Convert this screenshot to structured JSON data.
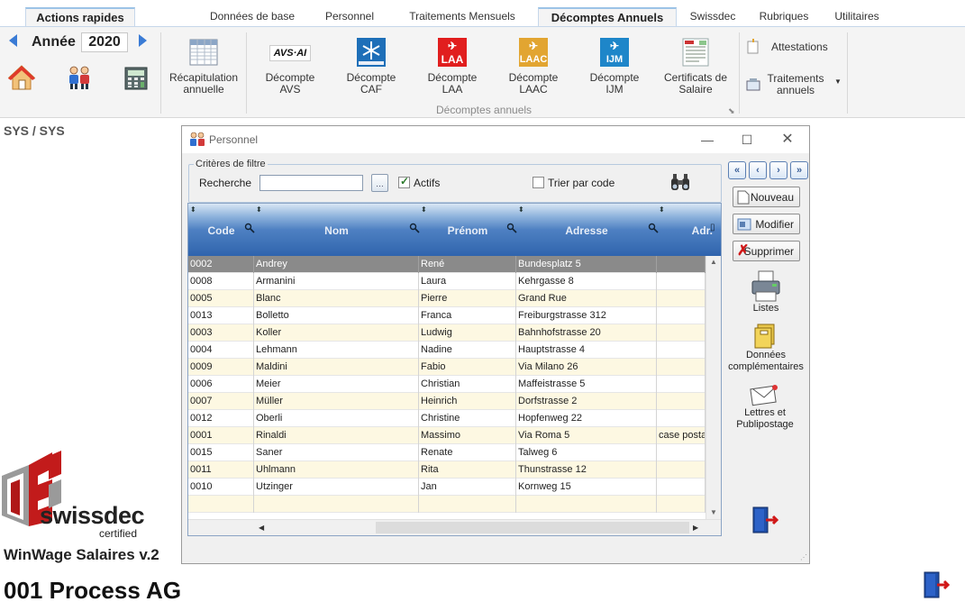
{
  "tabs": [
    "Actions rapides",
    "Données de base",
    "Personnel",
    "Traitements Mensuels",
    "Décomptes Annuels",
    "Swissdec",
    "Rubriques",
    "Utilitaires"
  ],
  "year": {
    "label": "Année",
    "value": "2020"
  },
  "ribbon": {
    "recap": "Récapitulation annuelle",
    "avs": "Décompte AVS",
    "caf": "Décompte CAF",
    "laa": "Décompte LAA",
    "laac": "Décompte LAAC",
    "ijm": "Décompte IJM",
    "certificats": "Certificats de Salaire",
    "group_label": "Décomptes annuels",
    "attestations": "Attestations",
    "traitements": "Traitements annuels",
    "icon_texts": {
      "avs": "AVS·AI",
      "laa": "LAA",
      "laac": "LAAC",
      "ijm": "IJM"
    }
  },
  "user": "SYS / SYS",
  "window": {
    "title": "Personnel",
    "filter": {
      "legend": "Critères de filtre",
      "search_label": "Recherche",
      "search_value": "",
      "actifs_label": "Actifs",
      "actifs_checked": true,
      "trier_label": "Trier par code",
      "trier_checked": false
    },
    "columns": [
      "Code",
      "Nom",
      "Prénom",
      "Adresse",
      "Adr."
    ],
    "rows": [
      [
        "0002",
        "Andrey",
        "René",
        "Bundesplatz 5",
        ""
      ],
      [
        "0008",
        "Armanini",
        "Laura",
        "Kehrgasse 8",
        ""
      ],
      [
        "0005",
        "Blanc",
        "Pierre",
        "Grand Rue",
        ""
      ],
      [
        "0013",
        "Bolletto",
        "Franca",
        "Freiburgstrasse 312",
        ""
      ],
      [
        "0003",
        "Koller",
        "Ludwig",
        "Bahnhofstrasse 20",
        ""
      ],
      [
        "0004",
        "Lehmann",
        "Nadine",
        "Hauptstrasse 4",
        ""
      ],
      [
        "0009",
        "Maldini",
        "Fabio",
        "Via Milano 26",
        ""
      ],
      [
        "0006",
        "Meier",
        "Christian",
        "Maffeistrasse 5",
        ""
      ],
      [
        "0007",
        "Müller",
        "Heinrich",
        "Dorfstrasse 2",
        ""
      ],
      [
        "0012",
        "Oberli",
        "Christine",
        "Hopfenweg 22",
        ""
      ],
      [
        "0001",
        "Rinaldi",
        "Massimo",
        "Via Roma 5",
        "case posta"
      ],
      [
        "0015",
        "Saner",
        "Renate",
        "Talweg 6",
        ""
      ],
      [
        "0011",
        "Uhlmann",
        "Rita",
        "Thunstrasse 12",
        ""
      ],
      [
        "0010",
        "Utzinger",
        "Jan",
        "Kornweg 15",
        ""
      ]
    ],
    "buttons": {
      "nouveau": "Nouveau",
      "modifier": "Modifier",
      "supprimer": "Supprimer"
    },
    "side": {
      "listes": "Listes",
      "donnees": "Données complémentaires",
      "lettres": "Lettres et Publipostage"
    }
  },
  "footer": {
    "swissdec": "swissdec",
    "certified": "certified",
    "app_version": "WinWage Salaires v.2",
    "company": "001 Process AG"
  },
  "colors": {
    "accent": "#2f64ad",
    "selected_row": "#8a8a8a",
    "alt_row": "#fdf8e2"
  }
}
